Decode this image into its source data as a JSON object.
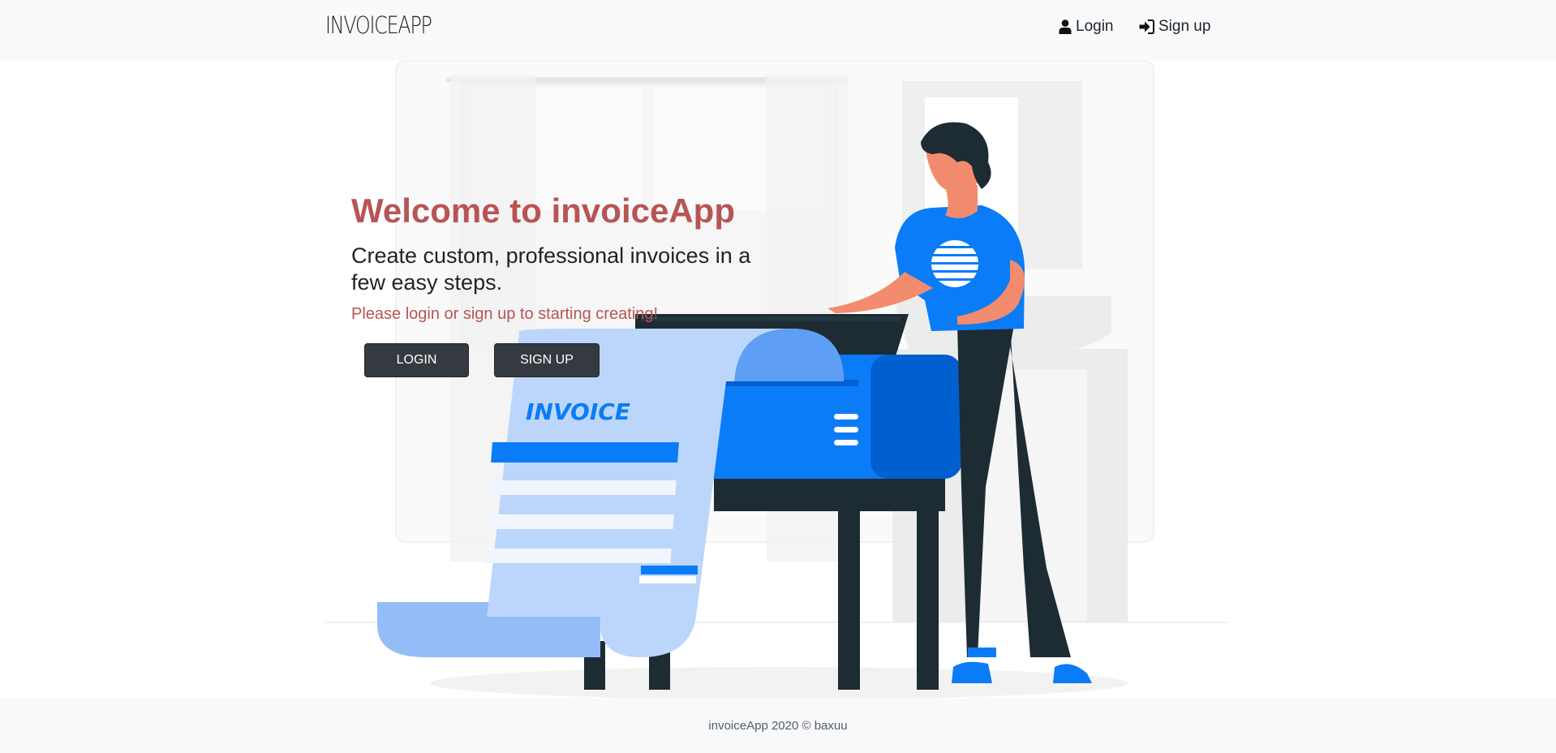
{
  "navbar": {
    "brand": "INVOICEAPP",
    "login_label": "Login",
    "signup_label": "Sign up"
  },
  "hero": {
    "title": "Welcome to invoiceApp",
    "subtitle": "Create custom, professional invoices in a few easy steps.",
    "prompt": "Please login or sign up to starting creating!",
    "login_button": "LOGIN",
    "signup_button": "SIGN UP",
    "illustration_text": "INVOICE"
  },
  "footer": {
    "text": "invoiceApp 2020 © baxuu"
  },
  "colors": {
    "accent_red": "#b85455",
    "dark_button": "#343a40",
    "illustration_blue": "#0a7cf7",
    "light_blue": "#bcd6fb",
    "dark_navy": "#1d2b33"
  }
}
